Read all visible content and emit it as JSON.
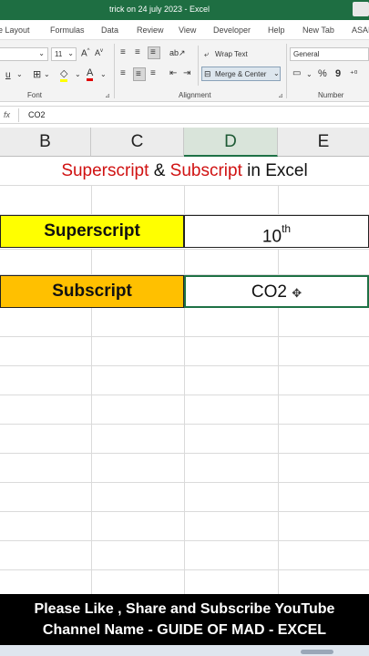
{
  "window": {
    "title": "trick on 24 july 2023  -  Excel"
  },
  "ribbon_tabs": [
    "e Layout",
    "Formulas",
    "Data",
    "Review",
    "View",
    "Developer",
    "Help",
    "New Tab",
    "ASAI"
  ],
  "ribbon": {
    "font_size": "11",
    "wrap_text": "Wrap Text",
    "merge_center": "Merge & Center",
    "number_format": "General",
    "font_group": "Font",
    "alignment_group": "Alignment",
    "number_group": "Number",
    "percent": "%",
    "comma": "9"
  },
  "formula_bar": {
    "fx": "fx",
    "value": "CO2"
  },
  "columns": [
    "B",
    "C",
    "D",
    "E"
  ],
  "active_column": "D",
  "sheet": {
    "title_part1": "Superscript",
    "title_amp": " & ",
    "title_part2": "Subscript",
    "title_rest": " in Excel",
    "row1_label": "Superscript",
    "row1_base": "10",
    "row1_sup": "th",
    "row2_label": "Subscript",
    "row2_value": "CO2",
    "row1_color": "#ffff00",
    "row2_color": "#ffc000"
  },
  "banner": {
    "line1": "Please Like , Share and Subscribe YouTube",
    "line2": "Channel Name - GUIDE OF MAD  - EXCEL"
  },
  "icons": [
    "font-color-icon",
    "fill-color-icon",
    "borders-icon",
    "wrap-text-icon",
    "merge-center-icon",
    "percent-icon",
    "comma-icon",
    "cell-cursor-icon"
  ]
}
